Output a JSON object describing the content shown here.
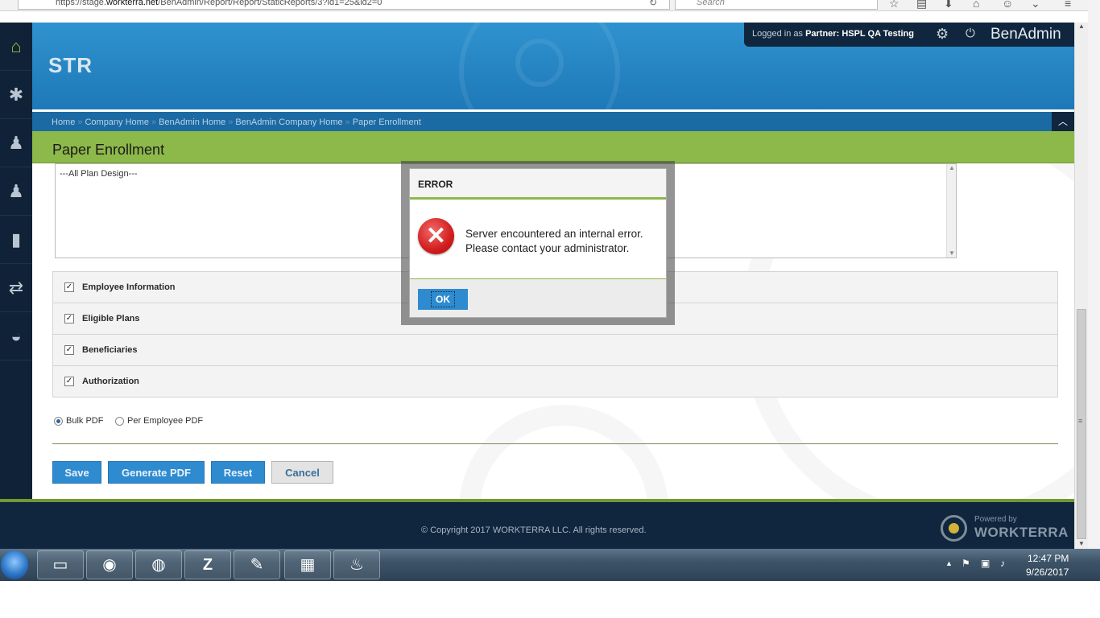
{
  "browser": {
    "url_prefix": "https://stage.",
    "url_host": "workterra.net",
    "url_path": "/BenAdmin/Report/Report/StaticReports/3?id1=25&id2=0",
    "search_placeholder": "Search"
  },
  "header": {
    "app_title": "STR",
    "logged_in_label": "Logged in as",
    "partner_label": "Partner:",
    "partner_name": "HSPL QA Testing",
    "brand": "BenAdmin"
  },
  "breadcrumb": [
    "Home",
    "Company Home",
    "BenAdmin Home",
    "BenAdmin Company Home",
    "Paper Enrollment"
  ],
  "breadcrumb_separator": "»",
  "page": {
    "title": "Paper Enrollment",
    "plan_design_option": "---All Plan Design---",
    "sections": [
      {
        "label": "Employee Information",
        "checked": true
      },
      {
        "label": "Eligible Plans",
        "checked": true
      },
      {
        "label": "Beneficiaries",
        "checked": true
      },
      {
        "label": "Authorization",
        "checked": true
      }
    ],
    "output_options": [
      {
        "label": "Bulk PDF",
        "selected": true
      },
      {
        "label": "Per Employee PDF",
        "selected": false
      }
    ],
    "buttons": {
      "save": "Save",
      "generate_pdf": "Generate PDF",
      "reset": "Reset",
      "cancel": "Cancel"
    }
  },
  "footer": {
    "copyright": "© Copyright 2017 WORKTERRA LLC. All rights reserved.",
    "powered_by": "Powered by",
    "powered_brand": "WORKTERRA"
  },
  "dialog": {
    "title": "ERROR",
    "message_line1": "Server encountered an internal error.",
    "message_line2": "Please contact your administrator.",
    "ok_label": "OK"
  },
  "taskbar": {
    "time": "12:47 PM",
    "date": "9/26/2017"
  },
  "colors": {
    "header_blue": "#1e78b8",
    "title_green": "#8db84a",
    "nav_dark": "#0f2237",
    "button_blue": "#2f8bd0",
    "error_red": "#d21d1d"
  }
}
